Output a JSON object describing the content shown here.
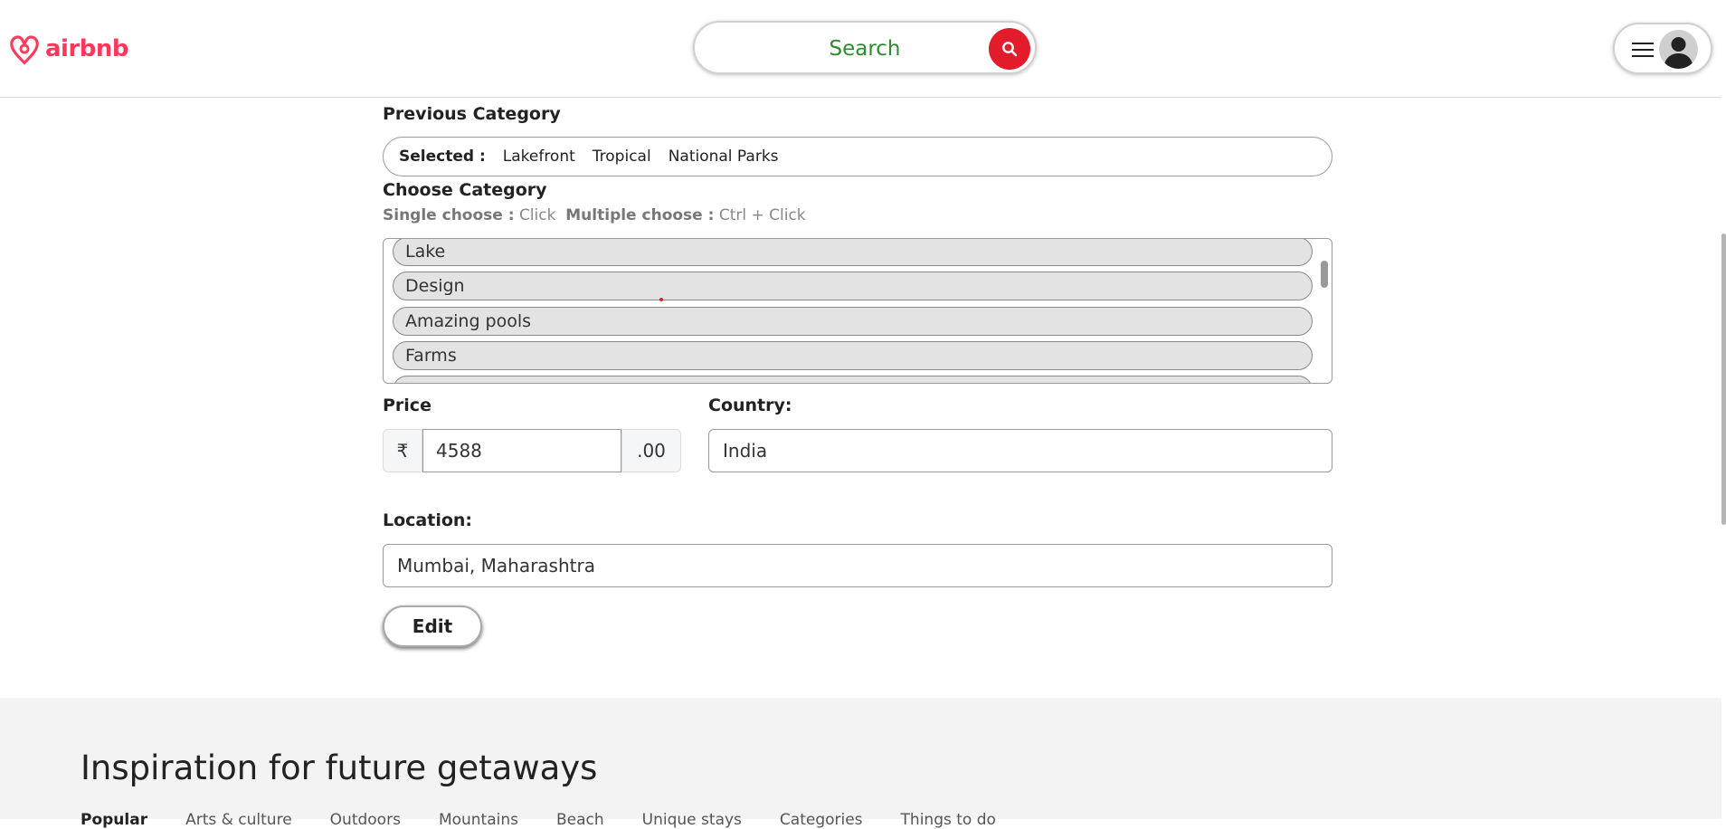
{
  "header": {
    "brand": "airbnb",
    "search_label": "Search"
  },
  "form": {
    "previous_category_label": "Previous Category",
    "selected_label": "Selected :",
    "selected_items": [
      "Lakefront",
      "Tropical",
      "National Parks"
    ],
    "choose_category_label": "Choose Category",
    "hint_single_key": "Single choose :",
    "hint_single_value": "Click",
    "hint_multi_key": "Multiple choose :",
    "hint_multi_value": "Ctrl + Click",
    "category_options": [
      "Lake",
      "Design",
      "Amazing pools",
      "Farms",
      ""
    ],
    "price_label": "Price",
    "currency_symbol": "₹",
    "price_value": "4588",
    "price_suffix": ".00",
    "country_label": "Country:",
    "country_value": "India",
    "location_label": "Location:",
    "location_value": "Mumbai, Maharashtra",
    "edit_button": "Edit"
  },
  "footer": {
    "title": "Inspiration for future getaways",
    "tabs": [
      "Popular",
      "Arts & culture",
      "Outdoors",
      "Mountains",
      "Beach",
      "Unique stays",
      "Categories",
      "Things to do"
    ]
  },
  "colors": {
    "brand": "#ff385c",
    "search_button": "#e31c2b",
    "search_text": "#2e8b2e",
    "option_bg": "#e3e3e3",
    "footer_bg": "#f4f3f3"
  },
  "icons": [
    "airbnb-logo-icon",
    "search-icon",
    "hamburger-menu-icon",
    "user-avatar-icon"
  ]
}
